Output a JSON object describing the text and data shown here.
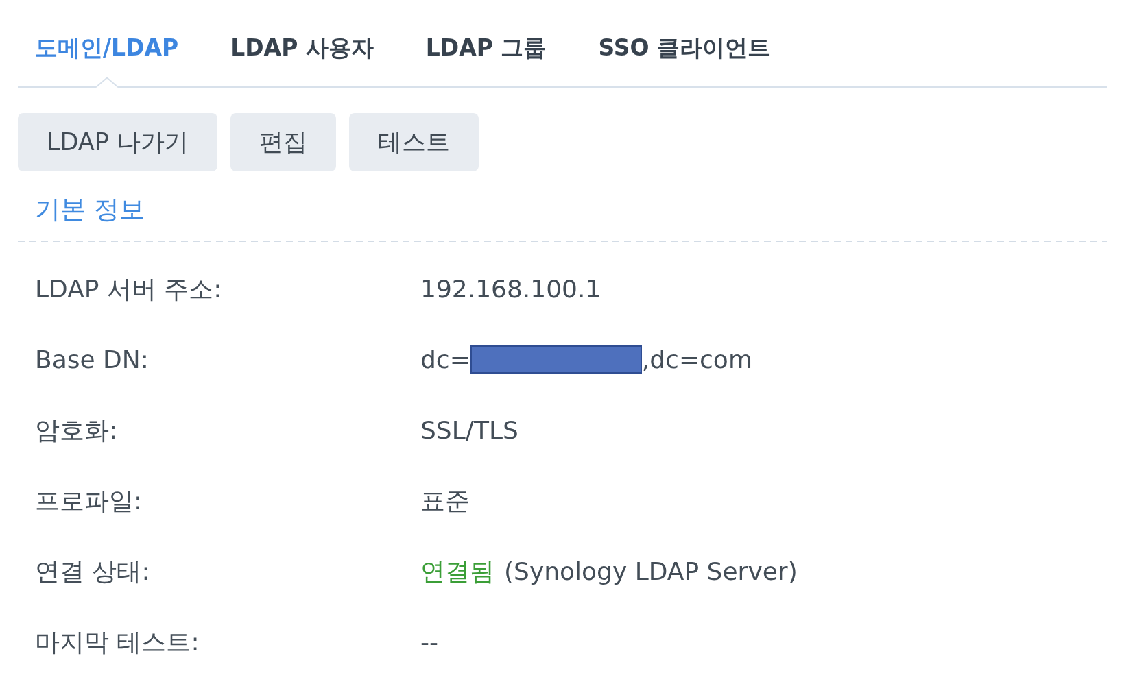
{
  "tabs": [
    {
      "label": "도메인/LDAP",
      "selected": true
    },
    {
      "label": "LDAP 사용자",
      "selected": false
    },
    {
      "label": "LDAP 그룹",
      "selected": false
    },
    {
      "label": "SSO 클라이언트",
      "selected": false
    }
  ],
  "toolbar": {
    "buttons": [
      "LDAP 나가기",
      "편집",
      "테스트"
    ]
  },
  "section": {
    "title": "기본 정보",
    "rows": [
      {
        "kind": "text",
        "label": "LDAP 서버 주소:",
        "value": "192.168.100.1"
      },
      {
        "kind": "redacted",
        "label": "Base DN:",
        "value_before": "dc=",
        "value_after": ",dc=com"
      },
      {
        "kind": "text",
        "label": "암호화:",
        "value": "SSL/TLS"
      },
      {
        "kind": "text",
        "label": "프로파일:",
        "value": "표준"
      },
      {
        "kind": "status",
        "label": "연결 상태:",
        "status": "연결됨",
        "connected": true,
        "detail": "(Synology LDAP Server)"
      },
      {
        "kind": "text",
        "label": "마지막 테스트:",
        "value": "--"
      }
    ]
  }
}
